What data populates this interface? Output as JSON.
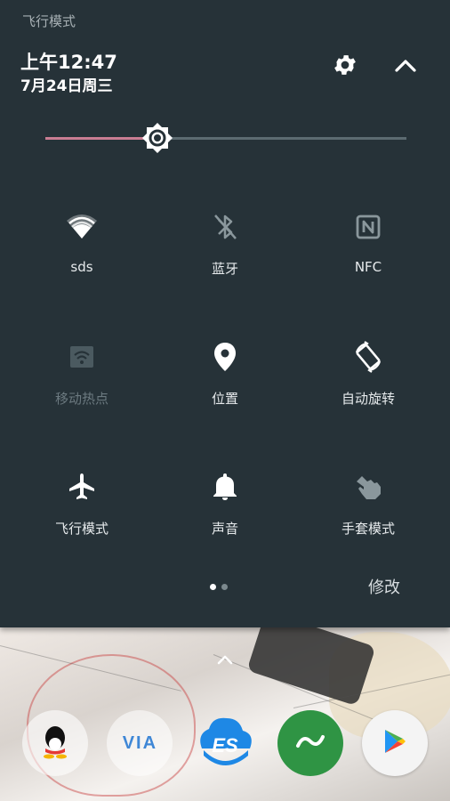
{
  "status_bar": {
    "label": "飞行模式"
  },
  "header": {
    "time": "上午12:47",
    "date": "7月24日周三"
  },
  "brightness": {
    "level": 0.31
  },
  "tiles": [
    {
      "label": "sds",
      "icon": "wifi-icon",
      "enabled": true
    },
    {
      "label": "蓝牙",
      "icon": "bluetooth-disabled-icon",
      "enabled": false
    },
    {
      "label": "NFC",
      "icon": "nfc-icon",
      "enabled": false
    },
    {
      "label": "移动热点",
      "icon": "hotspot-icon",
      "enabled": false
    },
    {
      "label": "位置",
      "icon": "location-icon",
      "enabled": true
    },
    {
      "label": "自动旋转",
      "icon": "auto-rotate-icon",
      "enabled": true
    },
    {
      "label": "飞行模式",
      "icon": "airplane-icon",
      "enabled": true
    },
    {
      "label": "声音",
      "icon": "bell-icon",
      "enabled": true
    },
    {
      "label": "手套模式",
      "icon": "glove-icon",
      "enabled": false
    }
  ],
  "pager": {
    "pages": 2,
    "current": 1
  },
  "edit": {
    "label": "修改"
  },
  "dock": {
    "apps": [
      {
        "name": "QQ",
        "icon": "qq-icon"
      },
      {
        "name": "VIA",
        "text": "VIA",
        "icon": "via-icon"
      },
      {
        "name": "ES",
        "text": "ES",
        "icon": "es-file-icon"
      },
      {
        "name": "360",
        "icon": "infinity-icon"
      },
      {
        "name": "Play",
        "icon": "play-store-icon"
      }
    ]
  },
  "colors": {
    "shade_bg": "#263238",
    "slider_fill": "#c97d93",
    "accent_green": "#2f9444"
  }
}
